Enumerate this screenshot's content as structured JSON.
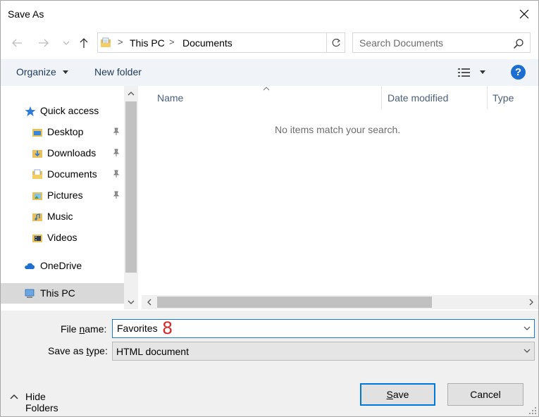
{
  "window": {
    "title": "Save As"
  },
  "address": {
    "crumbs": [
      "This PC",
      "Documents"
    ],
    "separator": ">"
  },
  "search": {
    "placeholder": "Search Documents"
  },
  "toolbar": {
    "organize_label": "Organize",
    "new_folder_label": "New folder",
    "help_label": "?"
  },
  "sidebar": {
    "items": [
      {
        "label": "Quick access",
        "icon": "star-icon",
        "pinned": false
      },
      {
        "label": "Desktop",
        "icon": "desktop-folder-icon",
        "pinned": true
      },
      {
        "label": "Downloads",
        "icon": "downloads-folder-icon",
        "pinned": true
      },
      {
        "label": "Documents",
        "icon": "documents-folder-icon",
        "pinned": true
      },
      {
        "label": "Pictures",
        "icon": "pictures-folder-icon",
        "pinned": true
      },
      {
        "label": "Music",
        "icon": "music-folder-icon",
        "pinned": false
      },
      {
        "label": "Videos",
        "icon": "videos-folder-icon",
        "pinned": false
      },
      {
        "label": "OneDrive",
        "icon": "cloud-icon",
        "pinned": false
      },
      {
        "label": "This PC",
        "icon": "computer-icon",
        "pinned": false,
        "selected": true
      }
    ]
  },
  "content": {
    "columns": [
      "Name",
      "Date modified",
      "Type"
    ],
    "empty_message": "No items match your search."
  },
  "form": {
    "file_name_label": "File name:",
    "file_name_value": "Favorites",
    "step_annotation": "8",
    "save_as_type_label": "Save as type:",
    "save_as_type_value": "HTML document"
  },
  "footer": {
    "hide_folders_label": "Hide Folders",
    "save_label": "Save",
    "cancel_label": "Cancel"
  },
  "colors": {
    "accent": "#0078d7",
    "annotation": "#d32a2a",
    "command_bar_bg": "#f0f4f9"
  }
}
